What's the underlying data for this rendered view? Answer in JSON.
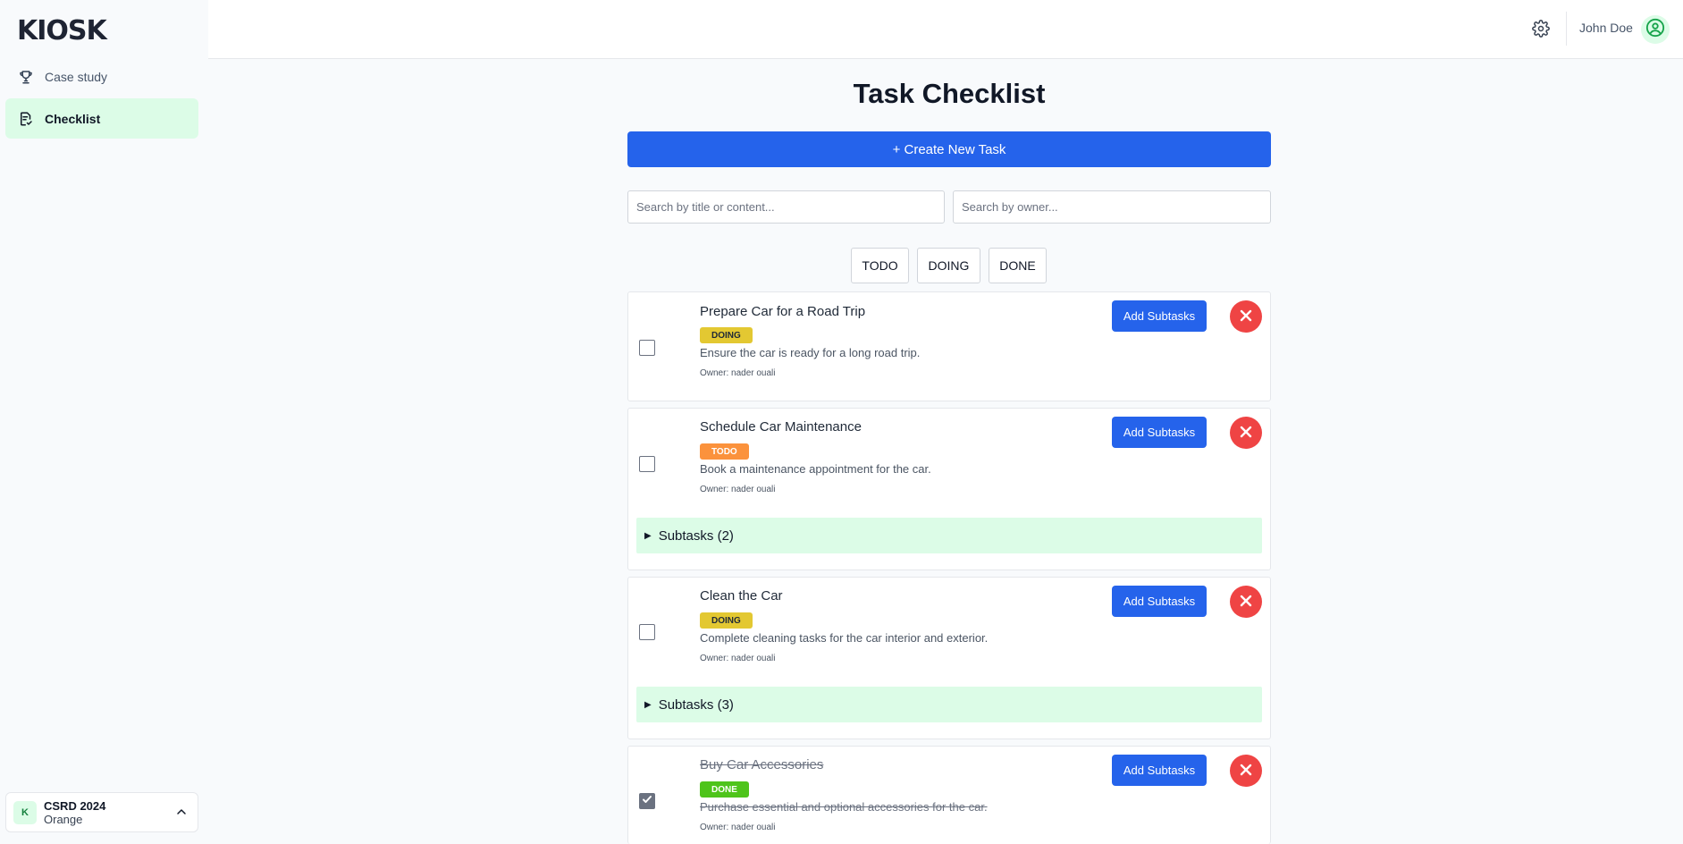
{
  "app": {
    "logo": "KIOSK"
  },
  "sidebar": {
    "items": [
      {
        "label": "Case study",
        "icon": "trophy-icon"
      },
      {
        "label": "Checklist",
        "icon": "checklist-icon",
        "active": true
      }
    ],
    "org": {
      "badge": "K",
      "name": "CSRD 2024",
      "sub": "Orange"
    }
  },
  "header": {
    "user": "John Doe"
  },
  "main": {
    "title": "Task Checklist",
    "create_label": "+ Create New Task",
    "search_title_placeholder": "Search by title or content...",
    "search_owner_placeholder": "Search by owner...",
    "filters": [
      "TODO",
      "DOING",
      "DONE"
    ]
  },
  "tasks": [
    {
      "title": "Prepare Car for a Road Trip",
      "status": "DOING",
      "description": "Ensure the car is ready for a long road trip.",
      "owner": "Owner: nader ouali",
      "checked": false,
      "add_label": "Add Subtasks"
    },
    {
      "title": "Schedule Car Maintenance",
      "status": "TODO",
      "description": "Book a maintenance appointment for the car.",
      "owner": "Owner: nader ouali",
      "checked": false,
      "add_label": "Add Subtasks",
      "subtasks": "Subtasks (2)"
    },
    {
      "title": "Clean the Car",
      "status": "DOING",
      "description": "Complete cleaning tasks for the car interior and exterior.",
      "owner": "Owner: nader ouali",
      "checked": false,
      "add_label": "Add Subtasks",
      "subtasks": "Subtasks (3)"
    },
    {
      "title": "Buy Car Accessories",
      "status": "DONE",
      "description": "Purchase essential and optional accessories for the car.",
      "owner": "Owner: nader ouali",
      "checked": true,
      "add_label": "Add Subtasks"
    }
  ],
  "colors": {
    "primary": "#2563eb",
    "active_bg": "#dcfce7",
    "danger": "#ef4444",
    "doing": "#e3c832",
    "todo": "#fb923c",
    "done": "#4ec41b"
  }
}
